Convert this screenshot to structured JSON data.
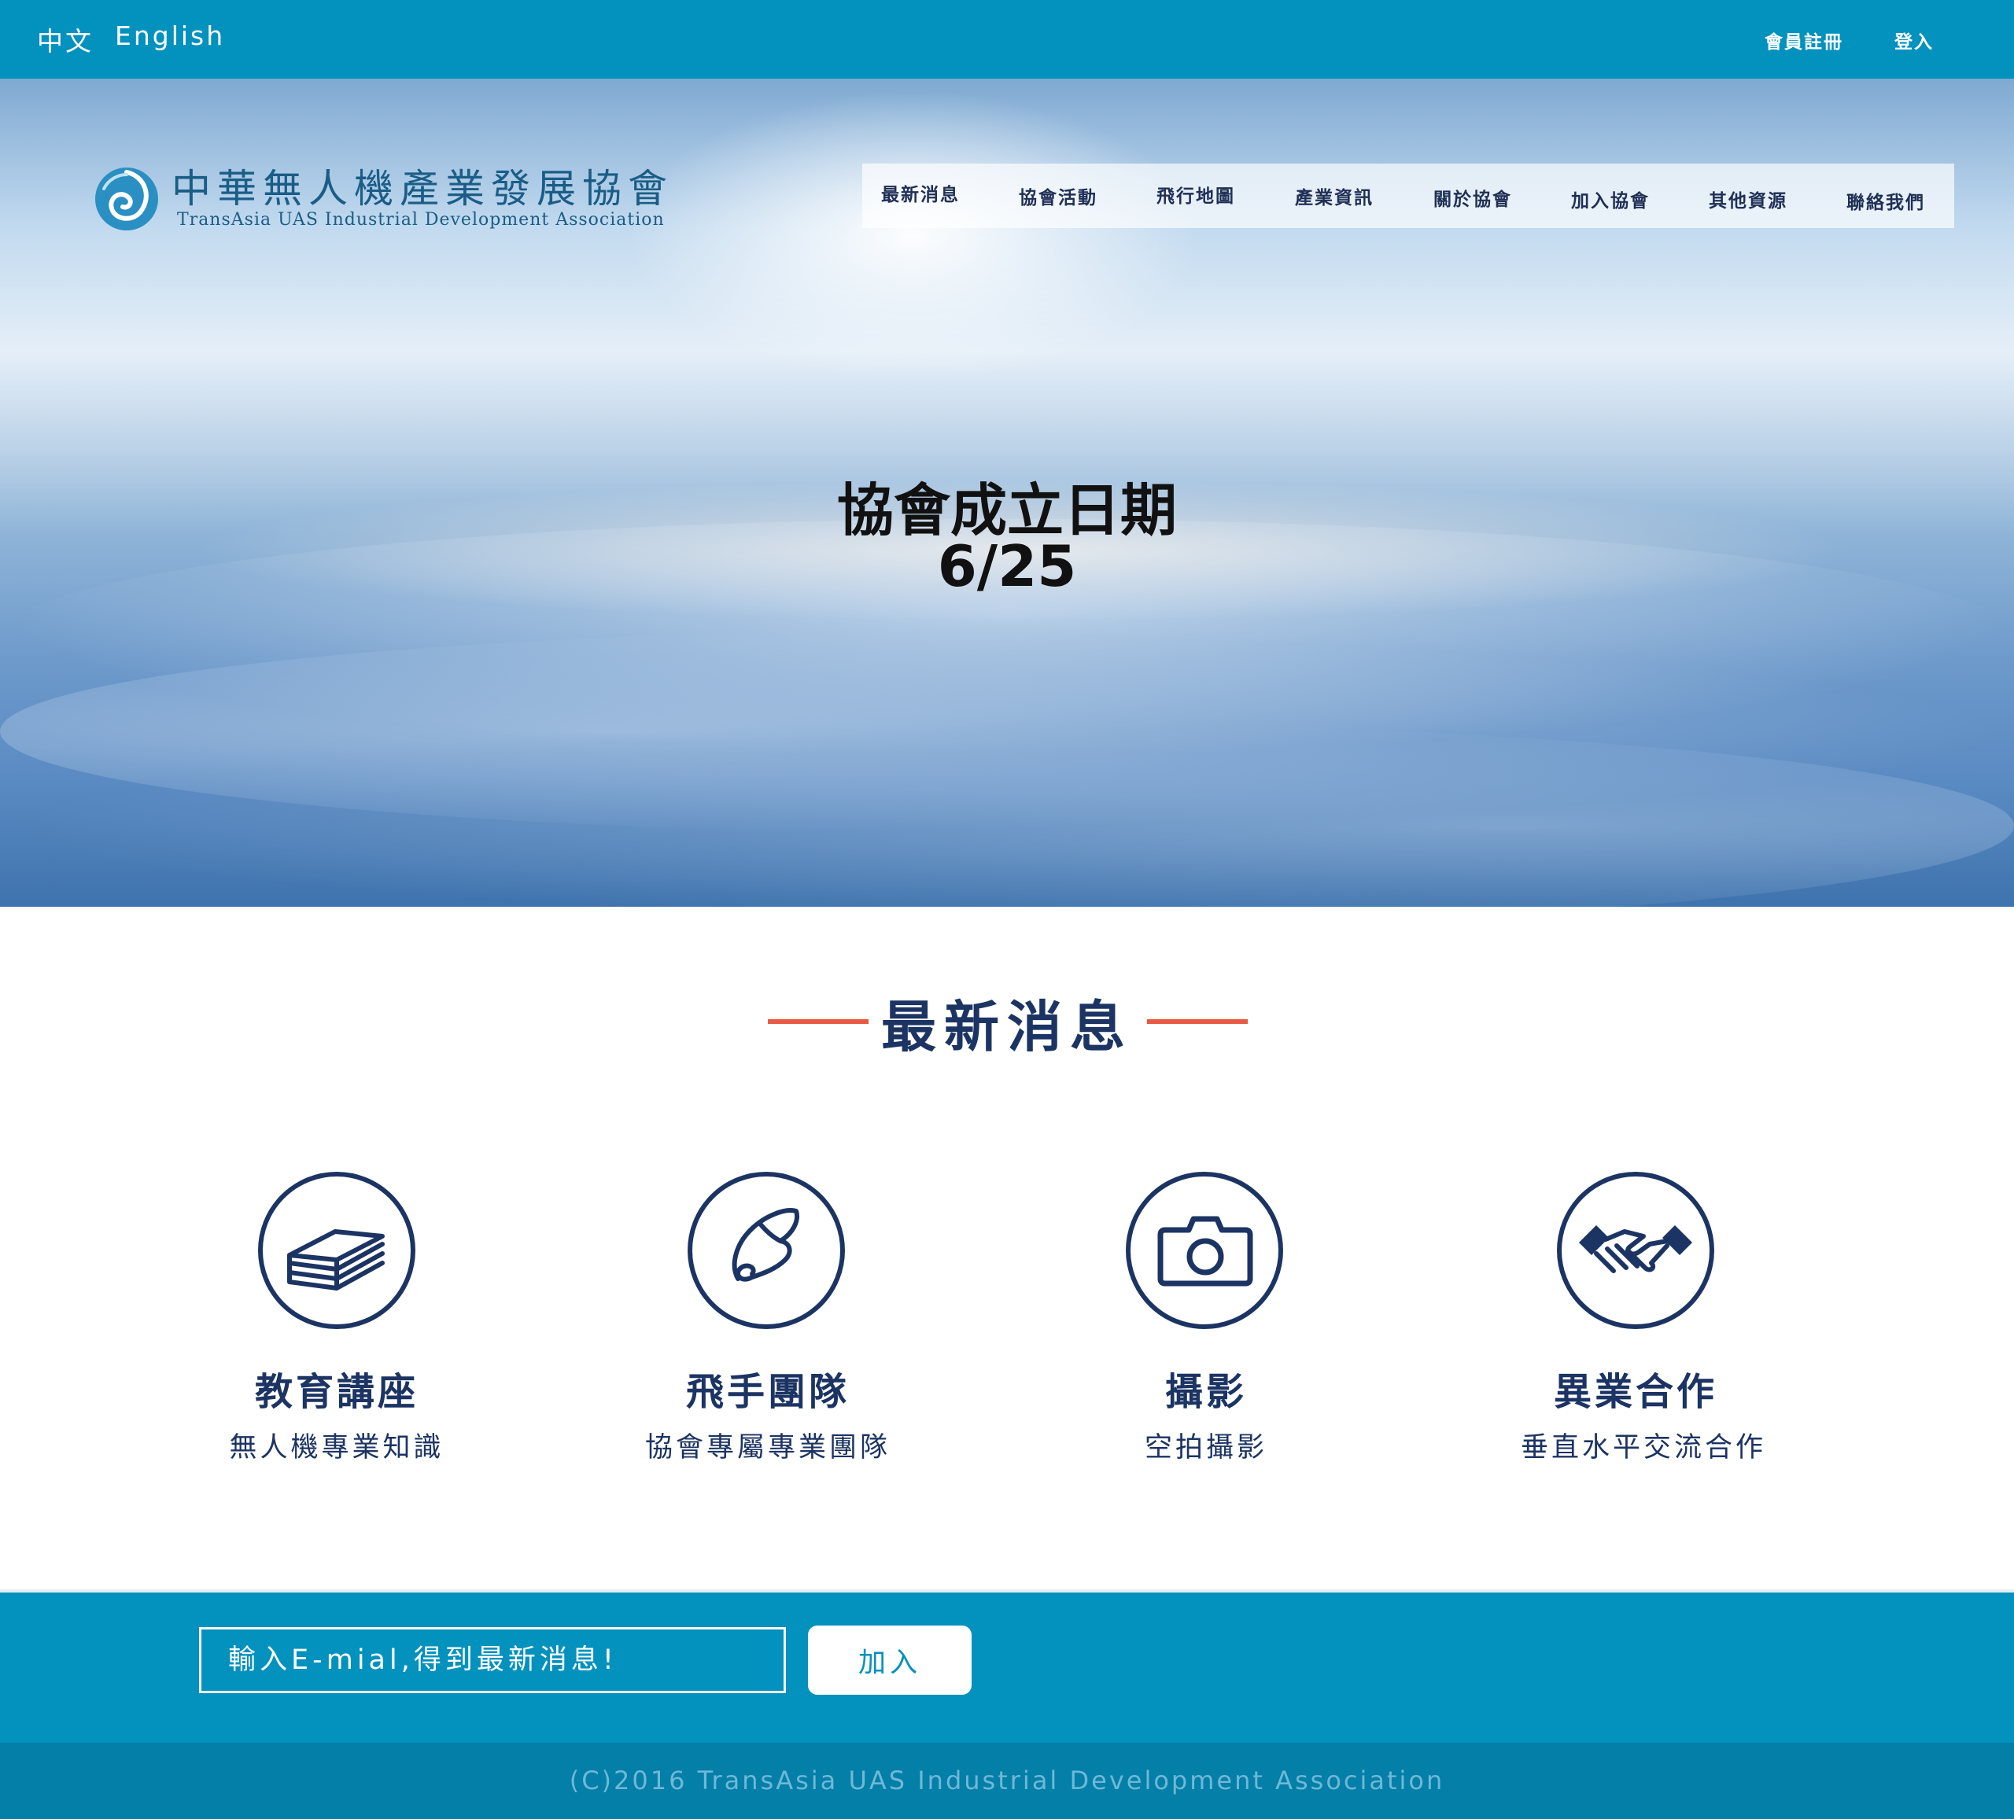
{
  "topbar": {
    "lang_zh": "中文",
    "lang_en": "English",
    "register": "會員註冊",
    "login": "登入"
  },
  "logo": {
    "title_cn": "中華無人機產業發展協會",
    "title_en": "TransAsia UAS Industrial Development Association"
  },
  "nav": {
    "items": [
      "最新消息",
      "協會活動",
      "飛行地圖",
      "產業資訊",
      "關於協會",
      "加入協會",
      "其他資源",
      "聯絡我們"
    ]
  },
  "hero": {
    "line1": "協會成立日期",
    "line2": "6/25"
  },
  "news_section": {
    "title": "最新消息"
  },
  "features": [
    {
      "title": "教育講座",
      "desc": "無人機專業知識",
      "icon": "books-icon"
    },
    {
      "title": "飛手團隊",
      "desc": "協會專屬專業團隊",
      "icon": "wing-icon"
    },
    {
      "title": "攝影",
      "desc": "空拍攝影",
      "icon": "camera-icon"
    },
    {
      "title": "異業合作",
      "desc": "垂直水平交流合作",
      "icon": "handshake-icon"
    }
  ],
  "subscribe": {
    "placeholder": "輸入E-mial,得到最新消息!",
    "button": "加入"
  },
  "footer": {
    "copyright": "(C)2016 TransAsia UAS Industrial Development Association"
  },
  "colors": {
    "brand_blue": "#0391be",
    "footer_blue": "#037fa8",
    "navy": "#1c3463",
    "accent_red": "#e85a44"
  }
}
